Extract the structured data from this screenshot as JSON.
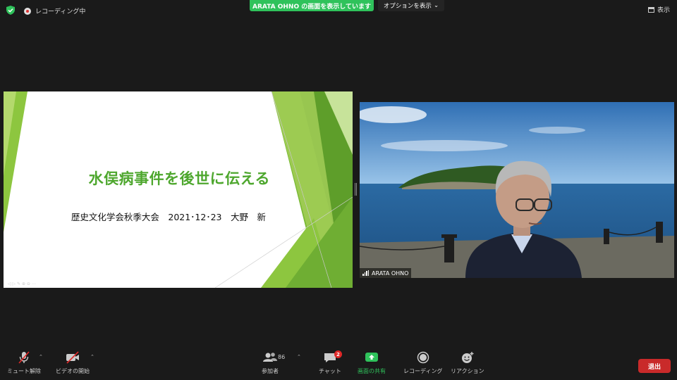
{
  "topbar": {
    "recording_label": "レコーディング中",
    "share_banner": "ARATA OHNO の画面を表示しています",
    "options_label": "オプションを表示",
    "view_label": "表示"
  },
  "slide": {
    "title": "水俣病事件を後世に伝える",
    "subtitle": "歴史文化学会秋季大会　2021･12･23　大野　新"
  },
  "video": {
    "participant_name": "ARATA OHNO"
  },
  "toolbar": {
    "mute_label": "ミュート解除",
    "video_label": "ビデオの開始",
    "participants_label": "参加者",
    "participants_count": "86",
    "chat_label": "チャット",
    "chat_badge": "2",
    "share_label": "画面の共有",
    "record_label": "レコーディング",
    "reaction_label": "リアクション",
    "leave_label": "退出"
  },
  "colors": {
    "share_green": "#2fc25b",
    "leave_red": "#c92a2a",
    "slide_title_green": "#4ea72e"
  }
}
